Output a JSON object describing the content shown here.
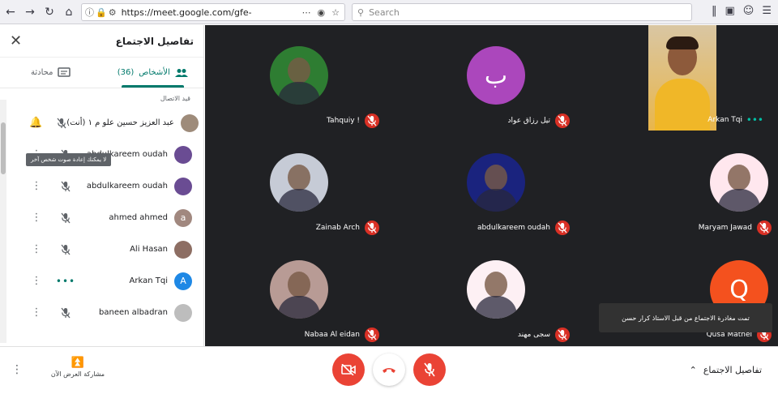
{
  "browser": {
    "url": "https://meet.google.com/gfe-apko-ft",
    "search_placeholder": "Search"
  },
  "sidebar": {
    "title": "تفاصيل الاجتماع",
    "tabs": [
      {
        "label": "الأشخاص",
        "count": "(36)"
      },
      {
        "label": "محادثة"
      }
    ],
    "section_label": "قيد الاتصال",
    "tooltip": "لا يمكنك إعادة صوت شخص آخر",
    "people": [
      {
        "name": "عبد العزيز حسين علو م ١ (أنت)",
        "avatar_color": "#9e8b7a",
        "action": "pin"
      },
      {
        "name": "abdulkareem oudah",
        "avatar_color": "#6a4c93",
        "action": "more"
      },
      {
        "name": "abdulkareem oudah",
        "avatar_color": "#6a4c93",
        "action": "more"
      },
      {
        "name": "ahmed ahmed",
        "avatar_color": "#a1887f",
        "avatar_letter": "a",
        "action": "more"
      },
      {
        "name": "Ali Hasan",
        "avatar_color": "#8d6e63",
        "action": "more"
      },
      {
        "name": "Arkan Tqi",
        "avatar_color": "#1e88e5",
        "avatar_letter": "A",
        "action": "more",
        "status": "speaking"
      },
      {
        "name": "baneen albadran",
        "avatar_color": "#bdbdbd",
        "action": "more"
      }
    ]
  },
  "tiles": [
    {
      "name": "Tahquiy !",
      "bg": "#2e7d32"
    },
    {
      "name": "تيل رزاق عواد",
      "bg": "#ab47bc",
      "letter": "ب"
    },
    {
      "name": "Arkan Tqi",
      "bg": "#d9c6a3"
    },
    {
      "name": "Zainab Arch",
      "bg": "#c6cbd6"
    },
    {
      "name": "abdulkareem oudah",
      "bg": "#1a237e"
    },
    {
      "name": "Maryam Jawad",
      "bg": "#ffe7ee"
    },
    {
      "name": "Nabaa Al eidan",
      "bg": "#b89b95"
    },
    {
      "name": "سجى مهند",
      "bg": "#fdf0f4"
    },
    {
      "name": "Qusa Matnei",
      "bg": "#f4511e",
      "letter": "Q"
    }
  ],
  "toast": "تمت مغادرة الاجتماع من قبل الاستاذ كرار حسن",
  "bottom": {
    "present_label": "مشاركة العرض الآن",
    "details_label": "تفاصيل الاجتماع"
  },
  "colors": {
    "accent": "#00796b",
    "danger": "#ea4335",
    "grid_bg": "#202124"
  }
}
